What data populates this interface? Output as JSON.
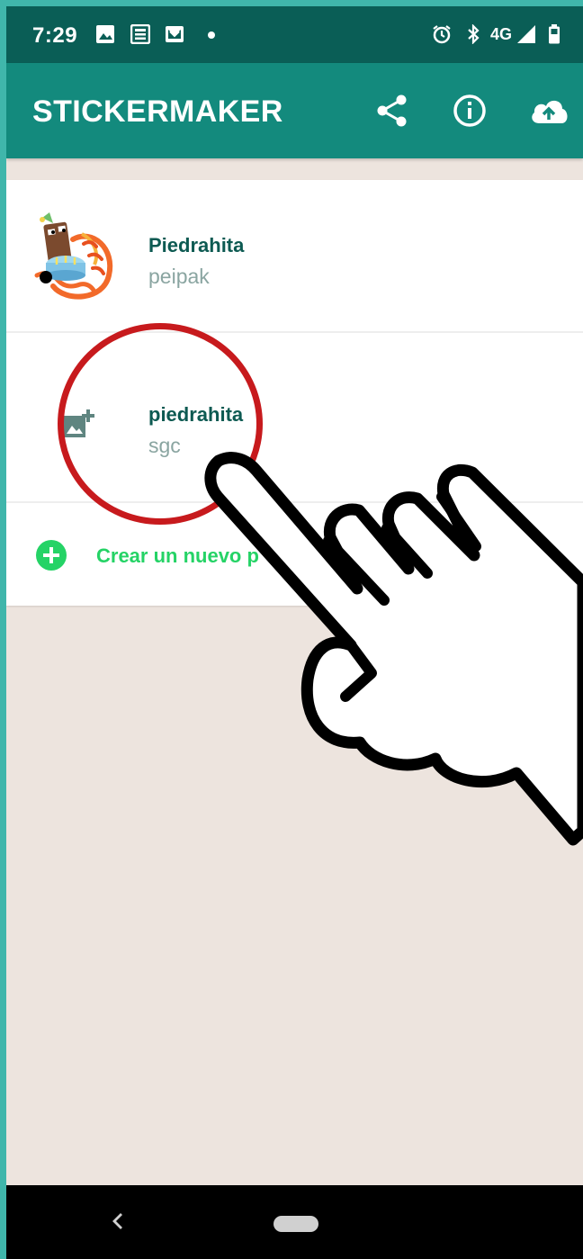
{
  "status_bar": {
    "time": "7:29",
    "network": "4G",
    "left_icons": [
      "image-icon",
      "news-icon",
      "mail-icon"
    ],
    "right_icons": [
      "alarm-icon",
      "bluetooth-icon",
      "signal-icon",
      "battery-icon"
    ]
  },
  "app_bar": {
    "title": "STICKERMAKER",
    "actions": [
      "share-icon",
      "info-icon",
      "cloud-upload-icon"
    ]
  },
  "packs": [
    {
      "name": "Piedrahita",
      "publisher": "peipak"
    },
    {
      "name": "piedrahita",
      "publisher": "sgc"
    }
  ],
  "create_pack": {
    "label": "Crear un nuevo p"
  },
  "colors": {
    "status_bar": "#0a5e56",
    "app_bar": "#138a7d",
    "accent_green": "#25d366",
    "highlight_red": "#c71a1d",
    "background": "#ede4de"
  }
}
